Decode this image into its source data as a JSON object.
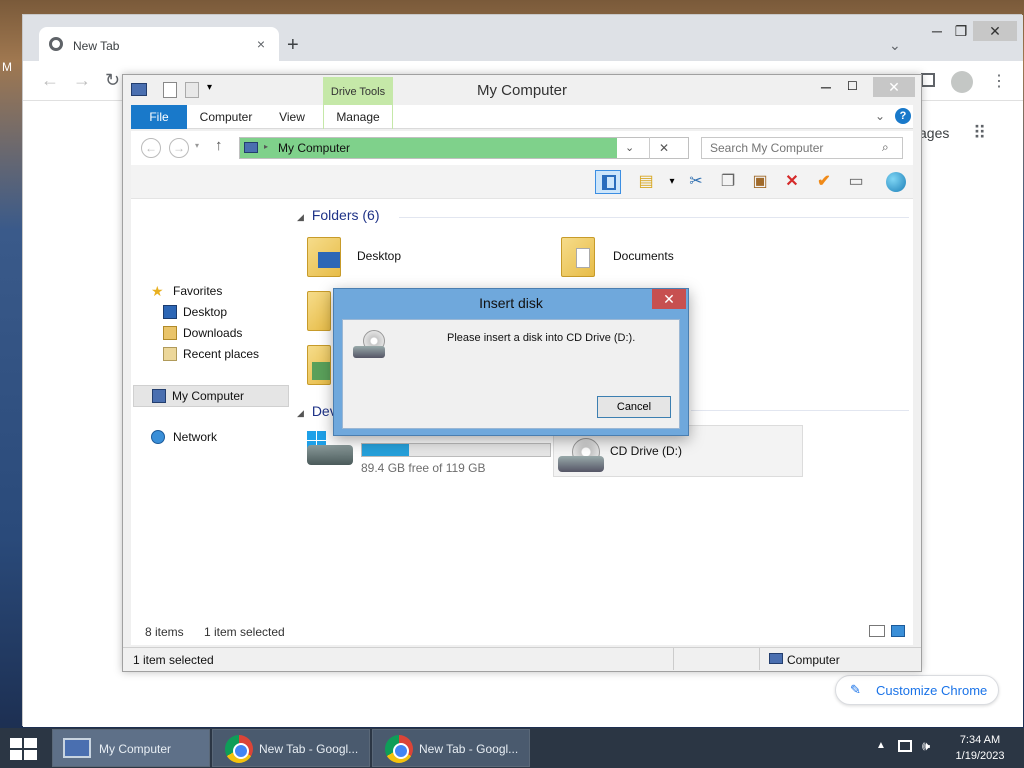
{
  "chrome": {
    "tab_title": "New Tab",
    "tab_close": "×",
    "new_tab": "+",
    "partial_link_text": "ages",
    "customize_label": "Customize Chrome"
  },
  "explorer": {
    "title": "My Computer",
    "drive_tools": "Drive Tools",
    "ribbon_tabs": [
      "File",
      "Computer",
      "View",
      "Manage"
    ],
    "address": "My Computer",
    "search_placeholder": "Search My Computer",
    "nav": {
      "favorites": "Favorites",
      "desktop": "Desktop",
      "downloads": "Downloads",
      "recent": "Recent places",
      "my_computer": "My Computer",
      "network": "Network"
    },
    "folders_header": "Folders (6)",
    "folder_desktop": "Desktop",
    "folder_documents": "Documents",
    "devices_header_partial": "Dev",
    "drive_c_free": "89.4 GB free of 119 GB",
    "drive_c_used_fraction": 0.25,
    "drive_d_label": "CD Drive (D:)",
    "status_items": "8 items",
    "status_selected": "1 item selected",
    "details_selected": "1 item selected",
    "details_location": "Computer"
  },
  "dialog": {
    "title": "Insert disk",
    "message": "Please insert a disk into CD Drive (D:).",
    "cancel": "Cancel"
  },
  "taskbar": {
    "items": [
      "My Computer",
      "New Tab - Googl...",
      "New Tab - Googl..."
    ],
    "time": "7:34 AM",
    "date": "1/19/2023"
  },
  "colors": {
    "ribbon_file": "#1979ca",
    "address_highlight": "#7fd18b",
    "drive_tools": "#c5e8a8",
    "dialog_frame": "#6fa8dc",
    "dialog_close": "#c75050",
    "progress": "#26a0da",
    "taskbar": "#2b3644"
  }
}
